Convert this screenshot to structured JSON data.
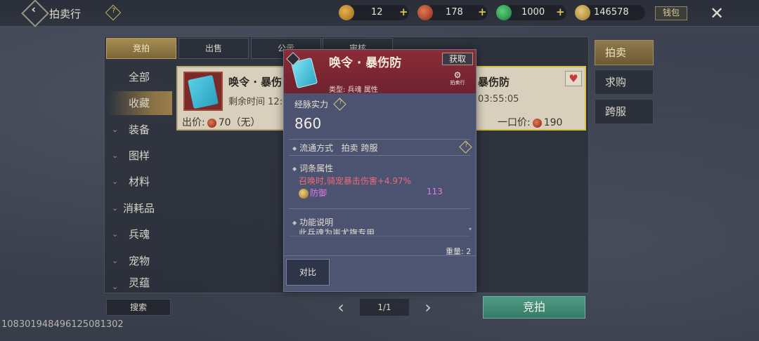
{
  "header": {
    "title": "拍卖行",
    "help": "?",
    "wallet_label": "钱包",
    "close": "✕",
    "currencies": [
      {
        "icon": "gold-ingot-icon",
        "value": "12",
        "color": "#c9902a"
      },
      {
        "icon": "red-coin-icon",
        "value": "178",
        "color": "#b8452e"
      },
      {
        "icon": "jade-icon",
        "value": "1000",
        "color": "#2e9a4a"
      },
      {
        "icon": "gold-leaf-icon",
        "value": "146578",
        "color": "#c9a24a"
      }
    ]
  },
  "tabs": [
    {
      "label": "竞拍",
      "active": true
    },
    {
      "label": "出售",
      "active": false
    },
    {
      "label": "公示",
      "active": false
    },
    {
      "label": "审核",
      "active": false
    }
  ],
  "categories": [
    {
      "label": "全部",
      "arrow": false,
      "active": false
    },
    {
      "label": "收藏",
      "arrow": false,
      "active": true
    },
    {
      "label": "装备",
      "arrow": true,
      "active": false
    },
    {
      "label": "图样",
      "arrow": true,
      "active": false
    },
    {
      "label": "材料",
      "arrow": true,
      "active": false
    },
    {
      "label": "消耗品",
      "arrow": true,
      "active": false
    },
    {
      "label": "兵魂",
      "arrow": true,
      "active": false
    },
    {
      "label": "宠物",
      "arrow": true,
      "active": false
    },
    {
      "label": "灵蕴",
      "arrow": true,
      "active": false
    }
  ],
  "cards": [
    {
      "title": "唤令 · 暴伤",
      "remaining_label": "剩余时间",
      "remaining_value": "12:",
      "price_label": "出价:",
      "price_value": "70（无）"
    },
    {
      "title": "暴伤防",
      "remaining_value": "03:55:05",
      "price_label": "一口价:",
      "price_value": "190",
      "favorited": true
    }
  ],
  "right_tabs": [
    {
      "label": "拍卖",
      "active": true
    },
    {
      "label": "求购",
      "active": false
    },
    {
      "label": "跨服",
      "active": false
    }
  ],
  "bottom": {
    "search_label": "搜索",
    "page": "1/1",
    "bid_label": "竞拍",
    "uid": "108301948496125081302"
  },
  "popup": {
    "name": "唤令 · 暴伤防",
    "acquire_label": "获取",
    "auction_mark": "拍卖行",
    "type_line": "类型: 兵魂 属性",
    "power_label": "经脉实力",
    "power_value": "860",
    "circulation_label": "流通方式",
    "circulation_value": "拍卖 跨服",
    "attr_section": "词条属性",
    "attr_effect": "召唤时,骑宠暴击伤害+4.97%",
    "attr_stat_name": "防御",
    "attr_stat_value": "113",
    "func_section": "功能说明",
    "func_desc": "此兵魂为蚩尤旗专用",
    "weight": "重量: 2",
    "compare_label": "对比"
  }
}
